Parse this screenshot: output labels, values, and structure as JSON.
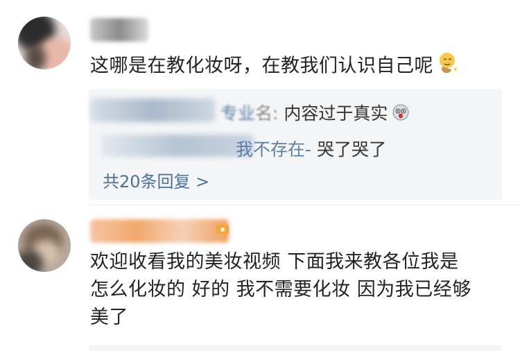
{
  "comments": [
    {
      "username": "",
      "text": "这哪是在教化妆呀，在教我们认识自己呢",
      "emoji_icon": "smiling-face-with-tear-icon",
      "replies": [
        {
          "author_visible": "专业",
          "text": "内容过于真实",
          "emoji_icon": "scared-face-icon"
        },
        {
          "author_visible": "我不存在-",
          "text": "哭了哭了"
        }
      ],
      "more_replies_label": "共20条回复 >"
    },
    {
      "username": "",
      "text_lines": [
        "欢迎收看我的美妆视频 下面我来教各位我是",
        "怎么化妆的 好的 我不需要化妆 因为我已经够",
        "美了"
      ]
    }
  ],
  "colors": {
    "reply_bg": "#f4f5f7",
    "link": "#4a6f9c",
    "username_tint": "#f2a86b"
  }
}
